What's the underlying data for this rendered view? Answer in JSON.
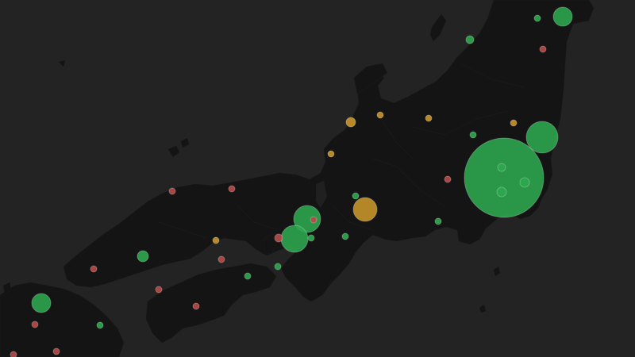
{
  "map": {
    "background": "#232323",
    "land_color": "#141414",
    "status_colors": {
      "green": "#2ea84f",
      "orange": "#c9962a",
      "red": "#b84a4a"
    },
    "markers": [
      {
        "id": "tokyo",
        "status": "green",
        "size": "xl"
      },
      {
        "id": "tokyo-inner-1",
        "status": "green",
        "size": "xs"
      },
      {
        "id": "tokyo-inner-2",
        "status": "green",
        "size": "xs"
      },
      {
        "id": "tokyo-inner-3",
        "status": "green",
        "size": "xs"
      },
      {
        "id": "ibaraki",
        "status": "green",
        "size": "lg"
      },
      {
        "id": "kyoto",
        "status": "green",
        "size": "md"
      },
      {
        "id": "osaka",
        "status": "green",
        "size": "md"
      },
      {
        "id": "nagoya",
        "status": "orange",
        "size": "md"
      },
      {
        "id": "fukuoka",
        "status": "green",
        "size": "sm"
      },
      {
        "id": "sendai",
        "status": "green",
        "size": "sm"
      },
      {
        "id": "hiroshima",
        "status": "green",
        "size": "sm"
      }
    ]
  }
}
